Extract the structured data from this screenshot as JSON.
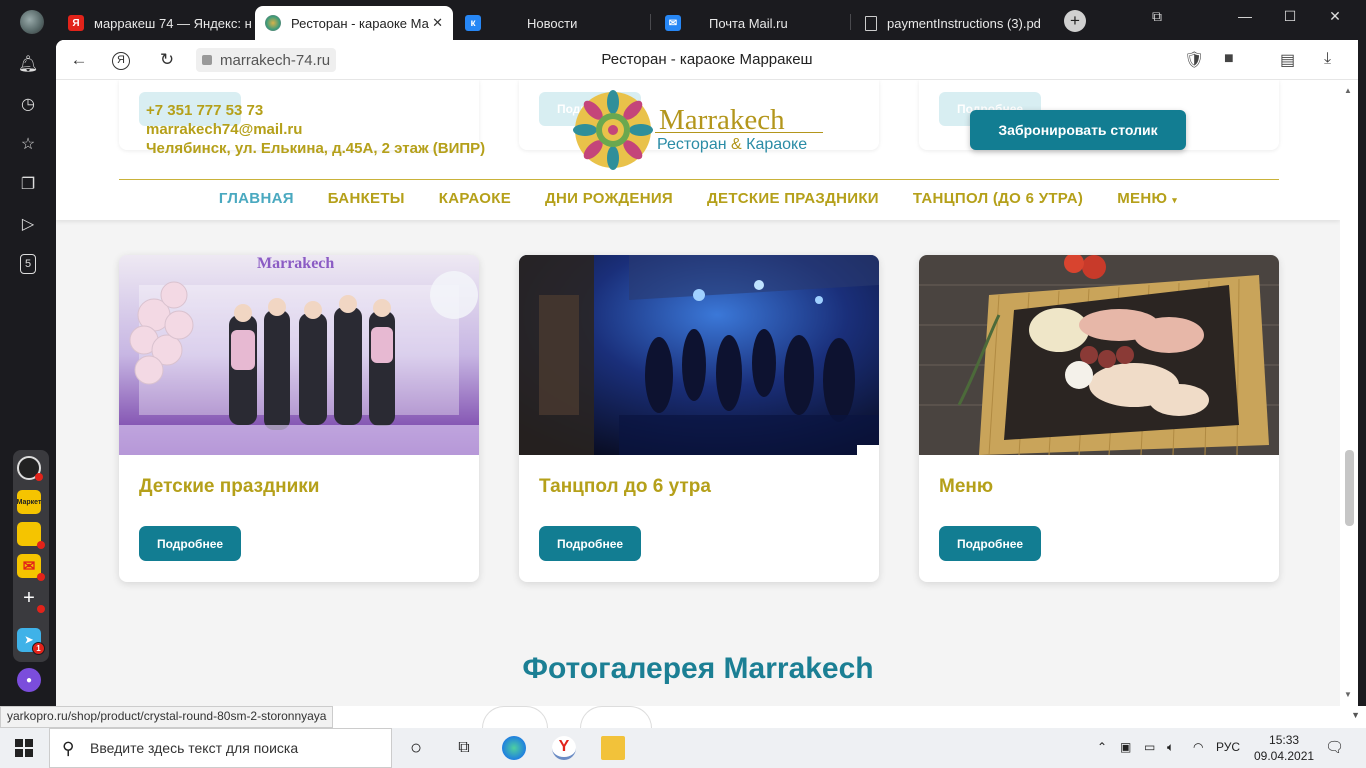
{
  "tabs": [
    {
      "title": "марракеш 74 — Яндекс: н",
      "favicon": "yandex-icon",
      "active": false
    },
    {
      "title": "Ресторан - караоке Ма",
      "favicon": "mandala-icon",
      "active": true
    },
    {
      "title": "Новости",
      "favicon": "vk-icon",
      "active": false
    },
    {
      "title": "Почта Mail.ru",
      "favicon": "mail-icon",
      "active": false
    },
    {
      "title": "paymentInstructions (3).pd",
      "favicon": "file-icon",
      "active": false
    }
  ],
  "address_bar": {
    "url": "marrakech-74.ru",
    "page_title": "Ресторан - караоке Марракеш"
  },
  "header": {
    "phone": "+7 351 777 53 73",
    "email": "marrakech74@mail.ru",
    "address": "Челябинск, ул. Елькина, д.45А, 2 этаж (ВИПР)",
    "ghost_button": "Подробнее",
    "logo_name": "Marrakech",
    "logo_sub_left": "Ресторан",
    "logo_sub_amp": "&",
    "logo_sub_right": "Караоке",
    "book_button": "Забронировать столик"
  },
  "menu": {
    "items": [
      "ГЛАВНАЯ",
      "БАНКЕТЫ",
      "КАРАОКЕ",
      "ДНИ РОЖДЕНИЯ",
      "ДЕТСКИЕ ПРАЗДНИКИ",
      "ТАНЦПОЛ (ДО 6 УТРА)",
      "МЕНЮ"
    ],
    "active_index": 0,
    "caret": "▾"
  },
  "cards": [
    {
      "title": "Детские праздники",
      "button": "Подробнее",
      "image": "kids-party-photo",
      "image_sign": "Marrakech"
    },
    {
      "title": "Танцпол до 6 утра",
      "button": "Подробнее",
      "image": "dance-floor-photo"
    },
    {
      "title": "Меню",
      "button": "Подробнее",
      "image": "food-platter-photo"
    }
  ],
  "gallery_title": "Фотогалерея Marrakech",
  "status_url": "yarkopro.ru/shop/product/crystal-round-80sm-2-storonnyaya",
  "taskbar": {
    "search_placeholder": "Введите здесь текст для поиска",
    "language": "РУС",
    "time": "15:33",
    "date": "09.04.2021"
  },
  "sidebar": {
    "market_label": "Маркет",
    "messenger_badge": "1",
    "tab_counter": "5"
  },
  "colors": {
    "brand_gold": "#b5a01a",
    "brand_teal": "#127d92",
    "menu_active": "#4aa9c0",
    "browser_chrome": "#1b1b1f"
  }
}
